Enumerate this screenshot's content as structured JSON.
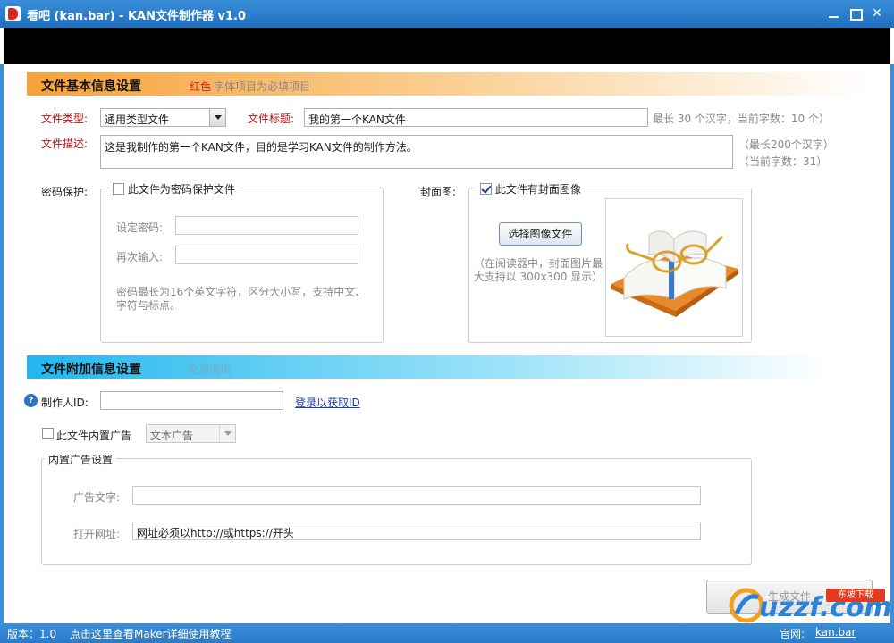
{
  "window": {
    "title": "看吧 (kan.bar) - KAN文件制作器 v1.0"
  },
  "basic_section": {
    "title": "文件基本信息设置",
    "note_red": "红色",
    "note_rest": "字体项目为必填项目",
    "file_type_label": "文件类型:",
    "file_type_value": "通用类型文件",
    "file_title_label": "文件标题:",
    "file_title_value": "我的第一个KAN文件",
    "file_title_hint": "最长 30 个汉字，当前字数：10 个）",
    "desc_label": "文件描述:",
    "desc_value": "这是我制作的第一个KAN文件，目的是学习KAN文件的制作方法。",
    "desc_hint_1": "（最长200个汉字）",
    "desc_hint_2": "（当前字数：31）"
  },
  "password": {
    "label": "密码保护:",
    "checkbox_label": "此文件为密码保护文件",
    "checked": false,
    "set_label": "设定密码:",
    "confirm_label": "再次输入:",
    "set_value": "",
    "confirm_value": "",
    "hint": "密码最长为16个英文字符，区分大小写，支持中文、字符与标点。"
  },
  "cover": {
    "label": "封面图:",
    "checkbox_label": "此文件有封面图像",
    "checked": true,
    "select_button": "选择图像文件",
    "hint": "（在阅读器中，封面图片最大支持以 300x300 显示）",
    "image_icon": "open-book-glasses-icon"
  },
  "extra_section": {
    "title": "文件附加信息设置",
    "note": "全部选填",
    "maker_id_label": "制作人ID:",
    "maker_id_value": "",
    "login_link": "登录以获取ID",
    "ad_checkbox_label": "此文件内置广告",
    "ad_checked": false,
    "ad_type_value": "文本广告",
    "ad_group_title": "内置广告设置",
    "ad_text_label": "广告文字:",
    "ad_text_value": "",
    "ad_url_label": "打开网址:",
    "ad_url_value": "网址必须以http://或https://开头"
  },
  "footer": {
    "generate_button": "生成文件"
  },
  "statusbar": {
    "version": "版本：1.0",
    "help_link": "点击这里查看Maker详细使用教程",
    "site_label": "官网:",
    "site_link": "kan.bar"
  },
  "watermark": {
    "text": "uzzf.com",
    "badge": "东坡下载"
  },
  "colors": {
    "titlebar": "#2f80d0",
    "orange_bar": "#f7a23a",
    "blue_bar": "#22b7ee",
    "required_red": "#c81010"
  }
}
